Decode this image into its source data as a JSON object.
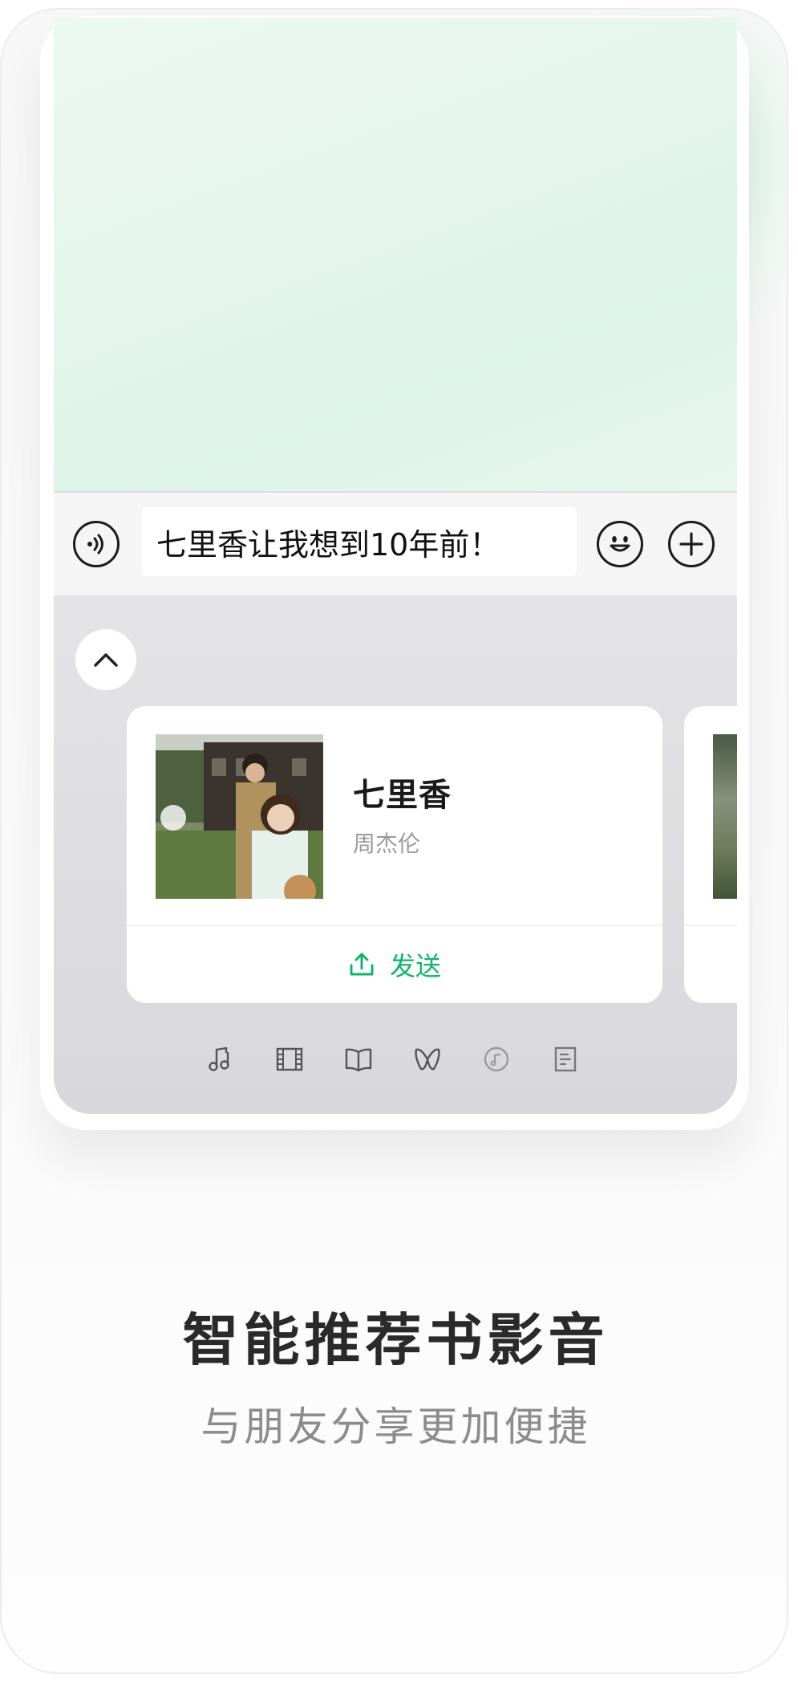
{
  "chat": {
    "input_value": "七里香让我想到10年前！"
  },
  "icons": {
    "voice": "voice-icon",
    "emoji": "emoji-icon",
    "plus": "plus-icon",
    "collapse": "chevron-up-icon",
    "send": "share-upload-icon",
    "tabs": [
      "music-icon",
      "film-icon",
      "book-icon",
      "butterfly-icon",
      "vinyl-icon",
      "document-icon"
    ]
  },
  "song_card": {
    "title": "七里香",
    "artist": "周杰伦",
    "send_label": "发送"
  },
  "footer": {
    "headline": "智能推荐书影音",
    "subline": "与朋友分享更加便捷"
  },
  "colors": {
    "accent_green": "#13b36b",
    "chat_bg": "#e6f6ee",
    "panel_bg": "#dedfe2"
  }
}
